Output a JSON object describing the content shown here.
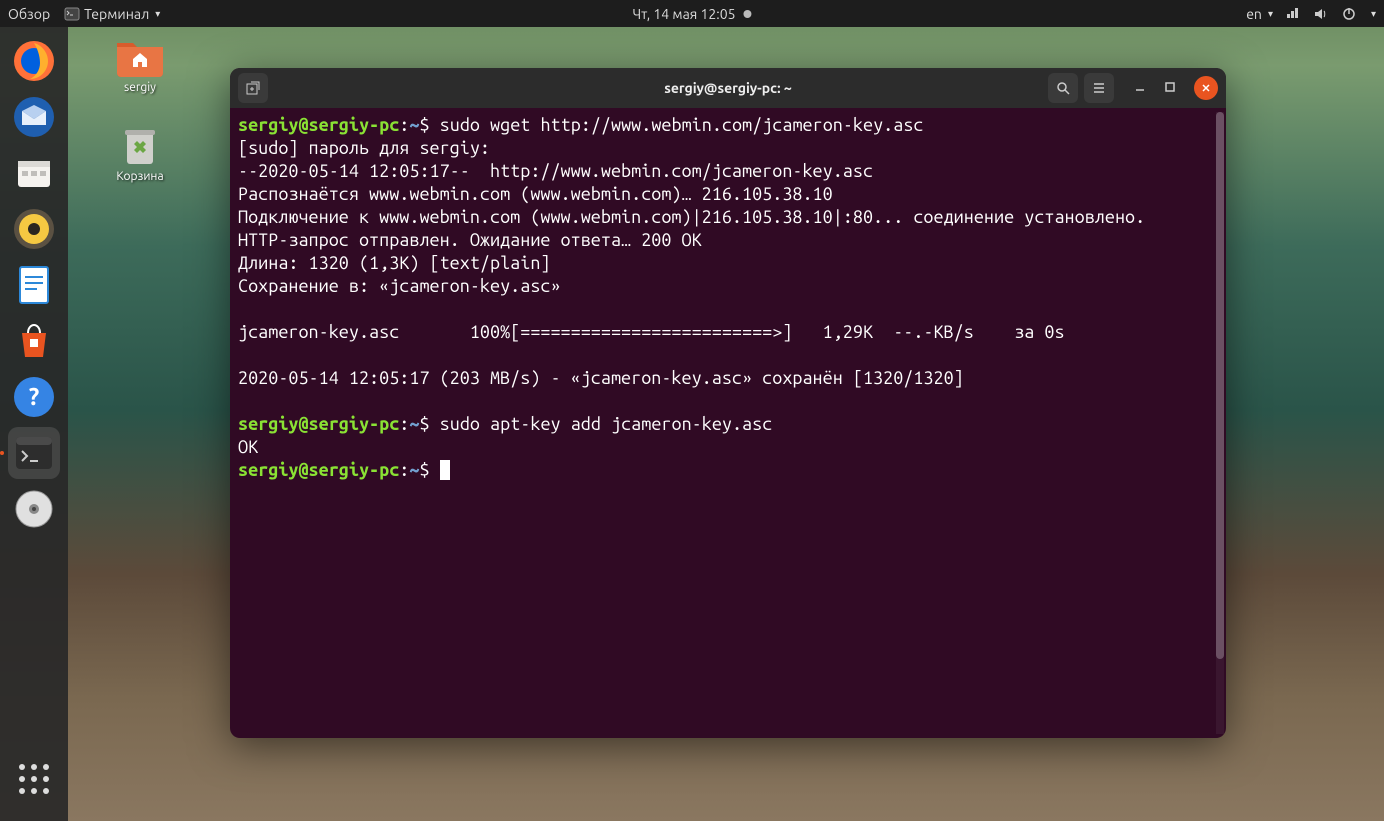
{
  "topbar": {
    "activities": "Обзор",
    "app_menu": "Терминал",
    "datetime": "Чт, 14 мая  12:05",
    "lang": "en"
  },
  "desktop": {
    "icons": [
      {
        "label": "sergiy"
      },
      {
        "label": "Корзина"
      }
    ]
  },
  "terminal": {
    "title": "sergiy@sergiy-pc: ~",
    "prompt": {
      "user": "sergiy@sergiy-pc",
      "path": "~",
      "sep": ":",
      "dollar": "$"
    },
    "lines": {
      "cmd1": "sudo wget http://www.webmin.com/jcameron-key.asc",
      "l2": "[sudo] пароль для sergiy: ",
      "l3": "--2020-05-14 12:05:17--  http://www.webmin.com/jcameron-key.asc",
      "l4": "Распознаётся www.webmin.com (www.webmin.com)… 216.105.38.10",
      "l5": "Подключение к www.webmin.com (www.webmin.com)|216.105.38.10|:80... соединение установлено.",
      "l6": "HTTP-запрос отправлен. Ожидание ответа… 200 OK",
      "l7": "Длина: 1320 (1,3K) [text/plain]",
      "l8": "Сохранение в: «jcameron-key.asc»",
      "l9": "jcameron-key.asc       100%[=========================>]   1,29K  --.-KB/s    за 0s",
      "l10": "2020-05-14 12:05:17 (203 MB/s) - «jcameron-key.asc» сохранён [1320/1320]",
      "cmd2": "sudo apt-key add jcameron-key.asc",
      "l12": "OK"
    }
  }
}
